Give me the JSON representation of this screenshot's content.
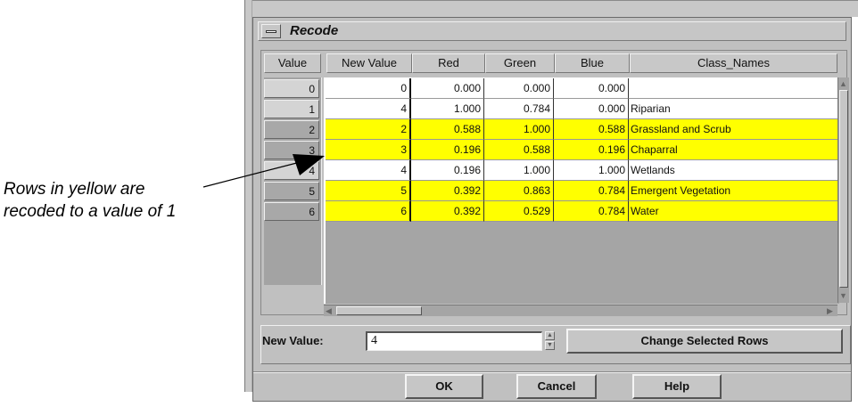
{
  "annotation": {
    "line1": "Rows in yellow are",
    "line2": "recoded to a value of 1"
  },
  "window": {
    "title": "Recode"
  },
  "table": {
    "headers": [
      "Value",
      "New Value",
      "Red",
      "Green",
      "Blue",
      "Class_Names"
    ],
    "rows": [
      {
        "value": "0",
        "new_value": "0",
        "red": "0.000",
        "green": "0.000",
        "blue": "0.000",
        "class_name": "",
        "highlighted": false
      },
      {
        "value": "1",
        "new_value": "4",
        "red": "1.000",
        "green": "0.784",
        "blue": "0.000",
        "class_name": "Riparian",
        "highlighted": false
      },
      {
        "value": "2",
        "new_value": "2",
        "red": "0.588",
        "green": "1.000",
        "blue": "0.588",
        "class_name": "Grassland and Scrub",
        "highlighted": true
      },
      {
        "value": "3",
        "new_value": "3",
        "red": "0.196",
        "green": "0.588",
        "blue": "0.196",
        "class_name": "Chaparral",
        "highlighted": true
      },
      {
        "value": "4",
        "new_value": "4",
        "red": "0.196",
        "green": "1.000",
        "blue": "1.000",
        "class_name": "Wetlands",
        "highlighted": false
      },
      {
        "value": "5",
        "new_value": "5",
        "red": "0.392",
        "green": "0.863",
        "blue": "0.784",
        "class_name": "Emergent Vegetation",
        "highlighted": true
      },
      {
        "value": "6",
        "new_value": "6",
        "red": "0.392",
        "green": "0.529",
        "blue": "0.784",
        "class_name": "Water",
        "highlighted": true
      }
    ]
  },
  "new_value": {
    "label": "New Value:",
    "value": "4"
  },
  "buttons": {
    "change_selected_rows": "Change Selected Rows",
    "ok": "OK",
    "cancel": "Cancel",
    "help": "Help"
  },
  "colors": {
    "highlight": "#ffff00",
    "window_bg": "#c0c0c0"
  }
}
